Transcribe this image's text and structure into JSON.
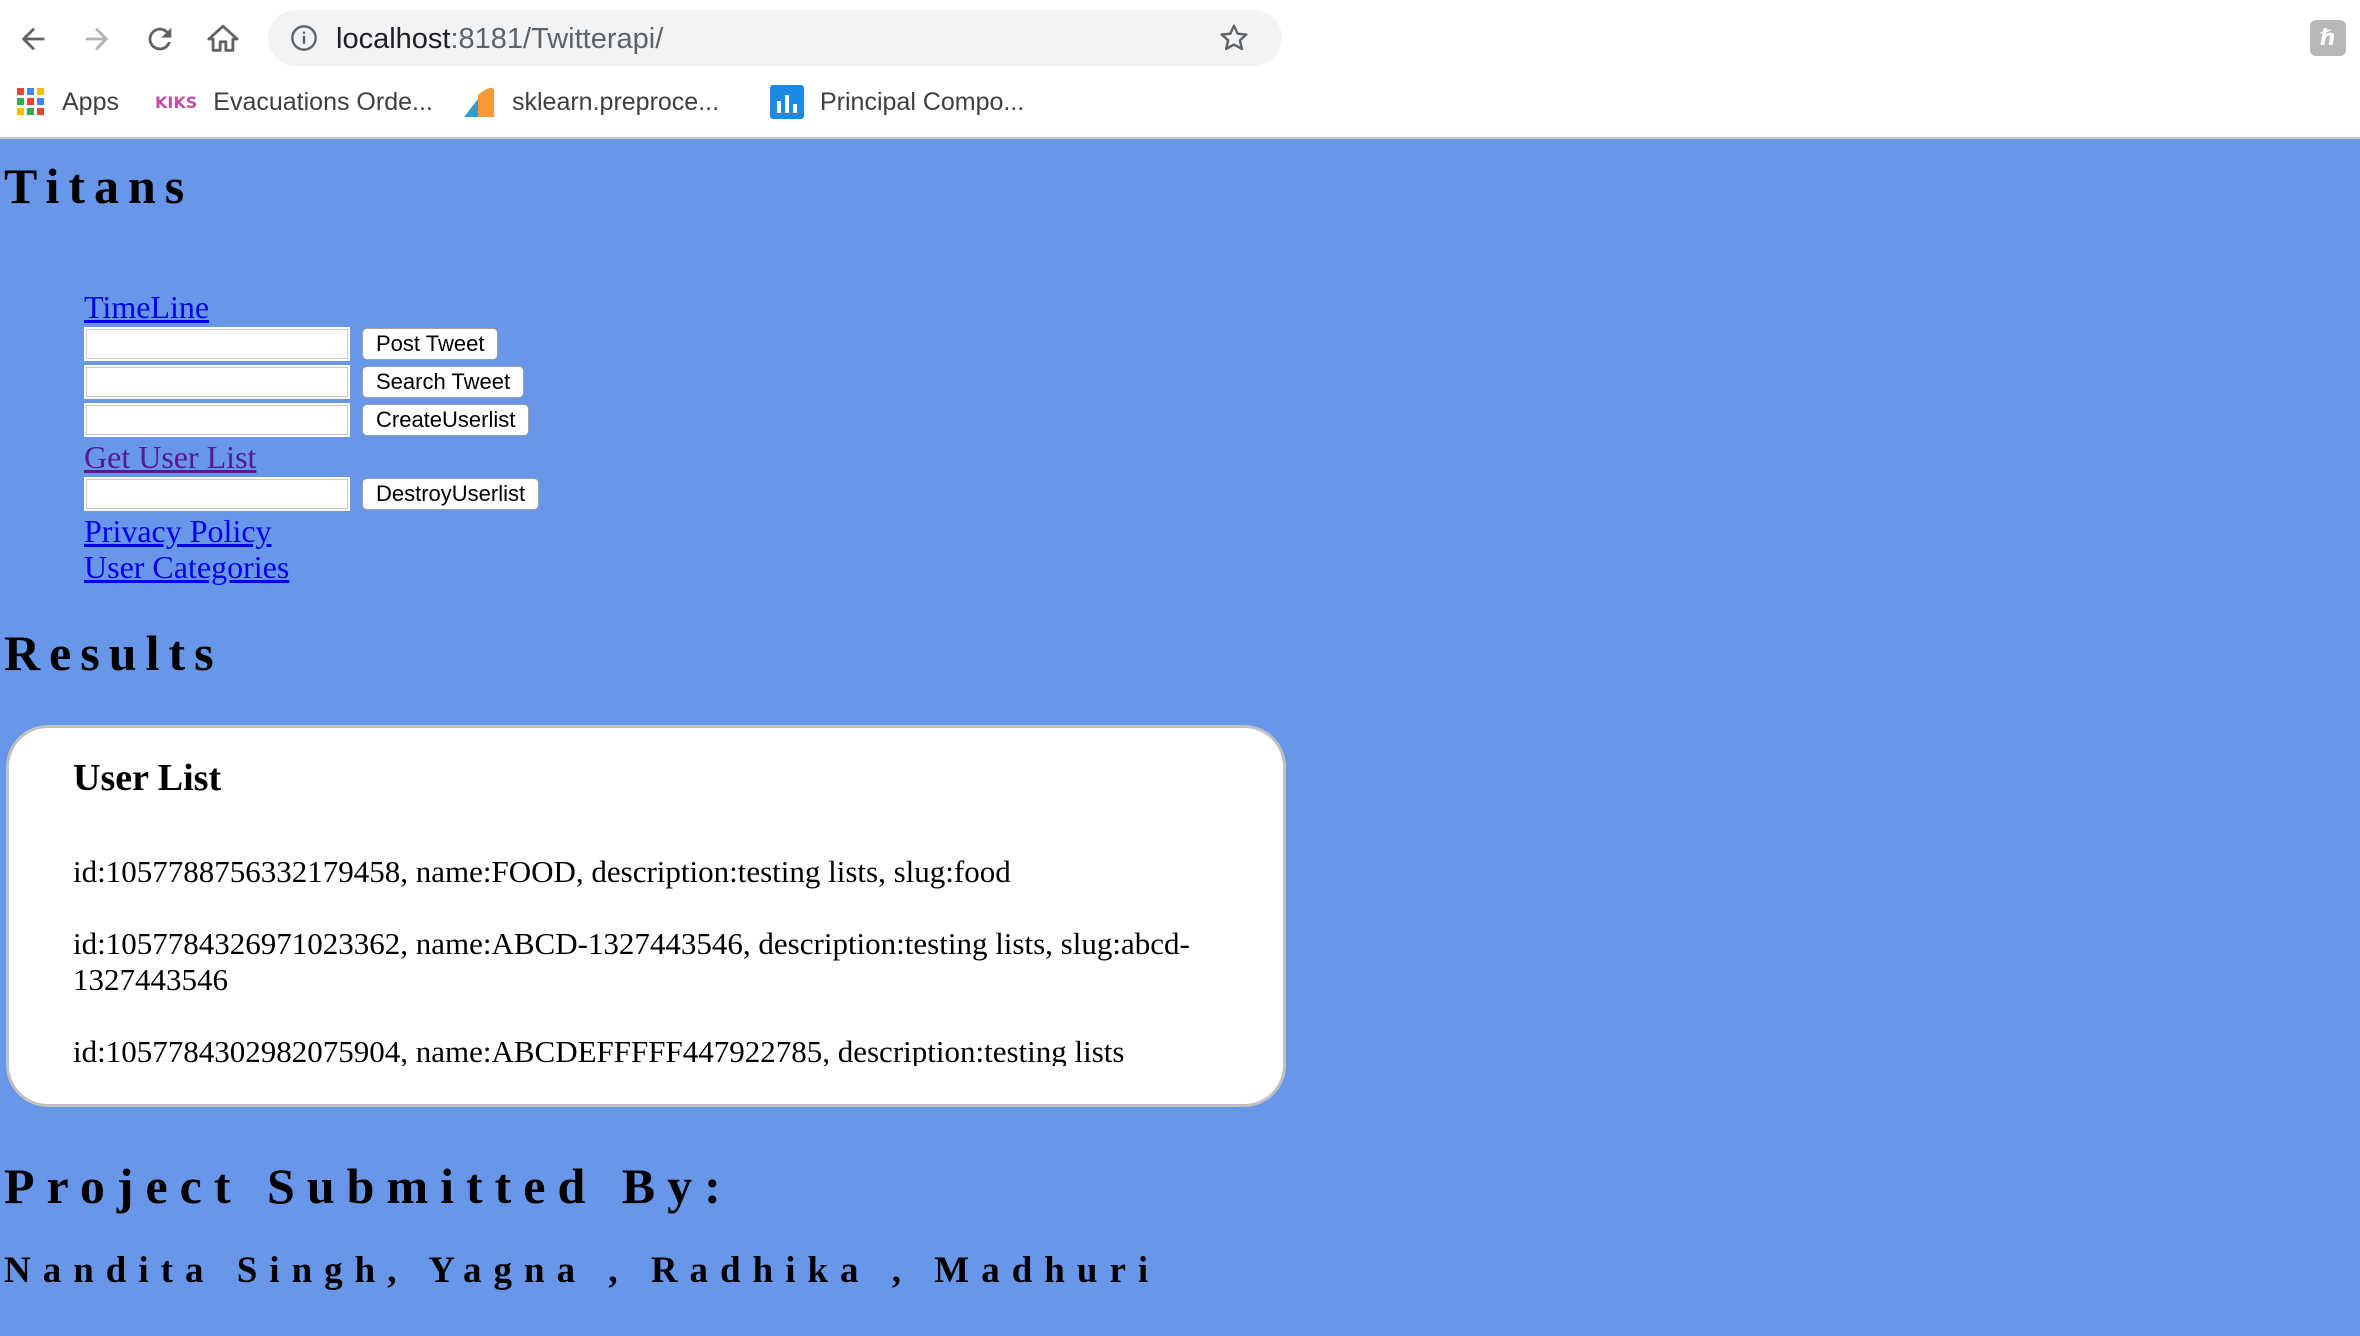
{
  "browser": {
    "url_host": "localhost",
    "url_rest": ":8181/Twitterapi/",
    "bookmarks": [
      {
        "label": "Apps",
        "icon": "apps-grid-icon"
      },
      {
        "label": "Evacuations Orde...",
        "icon": "kiks-favicon-icon"
      },
      {
        "label": "sklearn.preproce...",
        "icon": "sklearn-favicon-icon"
      },
      {
        "label": "Principal Compo...",
        "icon": "chart-favicon-icon"
      }
    ]
  },
  "page": {
    "title": "Titans",
    "menu": {
      "timeline_link": "TimeLine",
      "post_tweet_button": "Post Tweet",
      "search_tweet_button": "Search Tweet",
      "create_userlist_button": "CreateUserlist",
      "get_user_list_link": "Get User List",
      "destroy_userlist_button": "DestroyUserlist",
      "privacy_policy_link": "Privacy Policy",
      "user_categories_link": "User Categories"
    },
    "results_title": "Results",
    "result_box": {
      "heading": "User List",
      "entries": [
        "id:1057788756332179458, name:FOOD, description:testing lists, slug:food",
        "id:1057784326971023362, name:ABCD-1327443546, description:testing lists, slug:abcd-1327443546",
        "id:1057784302982075904, name:ABCDEFFFFF447922785, description:testing lists"
      ]
    },
    "submitted_title": "Project Submitted By:",
    "members": "Nandita Singh, Yagna , Radhika , Madhuri"
  },
  "colors": {
    "page_background": "#6896e9",
    "link": "#0000ee",
    "visited_link": "#551a8b"
  }
}
